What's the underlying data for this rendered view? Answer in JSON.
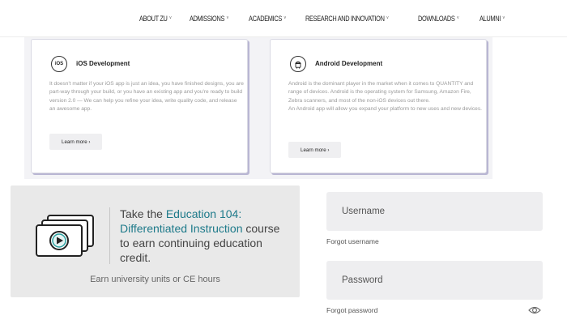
{
  "nav": {
    "items": [
      {
        "label": "ABOUT ZU"
      },
      {
        "label": "ADMISSIONS"
      },
      {
        "label": "ACADEMICS"
      },
      {
        "label": "RESEARCH AND INNOVATION"
      },
      {
        "label": "DOWNLOADS"
      },
      {
        "label": "ALUMNI"
      }
    ],
    "chevron": "˅"
  },
  "cards": {
    "ios": {
      "icon": "iOS",
      "title": "iOS Development",
      "text": "It doesn't matter if your iOS app is just an idea, you have finished designs, you are part-way through your build, or you have an existing app and you're ready to build version 2.0 — We can help you refine your idea, write quality code, and release an awesome app.",
      "button": "Learn more ›"
    },
    "android": {
      "icon": "android-icon",
      "title": "Android Development",
      "text": "Android is the dominant player in the market when it comes to QUANTITY and range of devices. Android is the operating system for Samsung, Amazon Fire, Zebra scanners, and most of the non-iOS devices out there.",
      "text2": "An Android app will allow you expand your platform to new uses and new devices.",
      "button": "Learn more ›"
    }
  },
  "promo": {
    "line_pre": "Take the ",
    "highlight": "Education 104: Differentiated Instruction",
    "line_post": " course to earn continuing education credit.",
    "sub": "Earn university units or CE hours",
    "accent": "#1e7a8a"
  },
  "login": {
    "username_placeholder": "Username",
    "forgot_username": "Forgot username",
    "password_placeholder": "Password",
    "forgot_password": "Forgot password"
  }
}
